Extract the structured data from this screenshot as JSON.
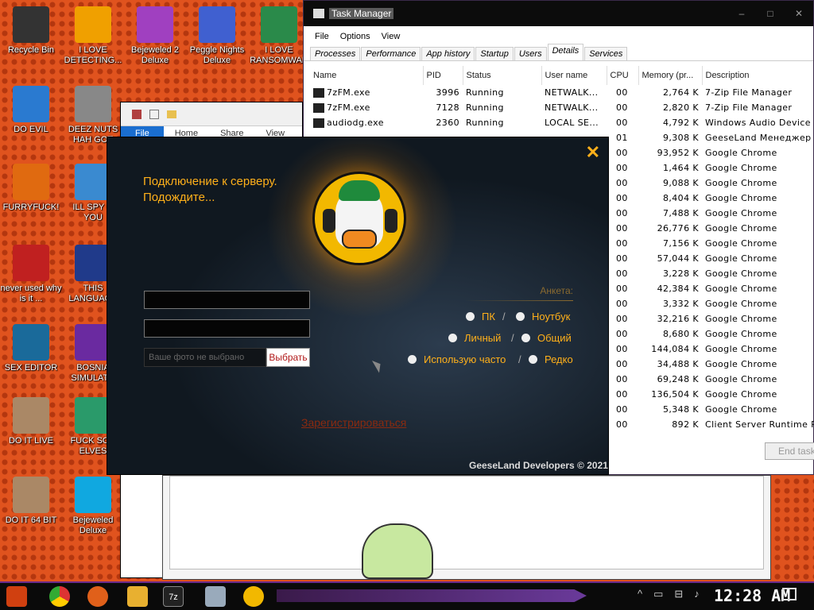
{
  "desktop": {
    "icons": [
      {
        "label": "Recycle Bin",
        "color": "#333"
      },
      {
        "label": "I LOVE DETECTING...",
        "color": "#f0a000"
      },
      {
        "label": "Bejeweled 2 Deluxe",
        "color": "#a040c0"
      },
      {
        "label": "Peggle Nights Deluxe",
        "color": "#4060d0"
      },
      {
        "label": "I LOVE RANSOMWAR",
        "color": "#2a8a4a"
      },
      {
        "label": "DO EVIL",
        "color": "#2a7ad0"
      },
      {
        "label": "DEEZ NUTS HAH GOT",
        "color": "#888"
      },
      {
        "label": "FURRYFUCK!",
        "color": "#e06a10"
      },
      {
        "label": "ILL SPY O YOU",
        "color": "#3a8ad0"
      },
      {
        "label": "never used why is it ...",
        "color": "#c02020"
      },
      {
        "label": "THIS LANGUAGE",
        "color": "#203a8a"
      },
      {
        "label": "SEX EDITOR",
        "color": "#1a6a9a"
      },
      {
        "label": "BOSNIA SIMULATO",
        "color": "#6a2aa0"
      },
      {
        "label": "DO IT LIVE",
        "color": "#aa8866"
      },
      {
        "label": "FUCK SON ELVES",
        "color": "#2a9a6a"
      },
      {
        "label": "DO IT 64 BIT",
        "color": "#aa8866"
      },
      {
        "label": "Bejeweled Deluxe",
        "color": "#10a8e0"
      }
    ]
  },
  "explorer": {
    "tabs": [
      "File",
      "Home",
      "Share",
      "View"
    ]
  },
  "task_manager": {
    "title": "Task Manager",
    "menu": [
      "File",
      "Options",
      "View"
    ],
    "tabs": [
      "Processes",
      "Performance",
      "App history",
      "Startup",
      "Users",
      "Details",
      "Services"
    ],
    "selected_tab": "Details",
    "columns": [
      "Name",
      "PID",
      "Status",
      "User name",
      "CPU",
      "Memory (pr...",
      "Description"
    ],
    "rows": [
      [
        "7zFM.exe",
        "3996",
        "Running",
        "NETWALK...",
        "00",
        "2,764 K",
        "7-Zip File Manager"
      ],
      [
        "7zFM.exe",
        "7128",
        "Running",
        "NETWALK...",
        "00",
        "2,820 K",
        "7-Zip File Manager"
      ],
      [
        "audiodg.exe",
        "2360",
        "Running",
        "LOCAL SE...",
        "00",
        "4,792 K",
        "Windows Audio Device ..."
      ],
      [
        "",
        "",
        "",
        "",
        "01",
        "9,308 K",
        "GeeseLand Менеджер"
      ],
      [
        "",
        "",
        "",
        "",
        "00",
        "93,952 K",
        "Google Chrome"
      ],
      [
        "",
        "",
        "",
        "",
        "00",
        "1,464 K",
        "Google Chrome"
      ],
      [
        "",
        "",
        "",
        "",
        "00",
        "9,088 K",
        "Google Chrome"
      ],
      [
        "",
        "",
        "",
        "",
        "00",
        "8,404 K",
        "Google Chrome"
      ],
      [
        "",
        "",
        "",
        "",
        "00",
        "7,488 K",
        "Google Chrome"
      ],
      [
        "",
        "",
        "",
        "",
        "00",
        "26,776 K",
        "Google Chrome"
      ],
      [
        "",
        "",
        "",
        "",
        "00",
        "7,156 K",
        "Google Chrome"
      ],
      [
        "",
        "",
        "",
        "",
        "00",
        "57,044 K",
        "Google Chrome"
      ],
      [
        "",
        "",
        "",
        "",
        "00",
        "3,228 K",
        "Google Chrome"
      ],
      [
        "",
        "",
        "",
        "",
        "00",
        "42,384 K",
        "Google Chrome"
      ],
      [
        "",
        "",
        "",
        "",
        "00",
        "3,332 K",
        "Google Chrome"
      ],
      [
        "",
        "",
        "",
        "",
        "00",
        "32,216 K",
        "Google Chrome"
      ],
      [
        "",
        "",
        "",
        "",
        "00",
        "8,680 K",
        "Google Chrome"
      ],
      [
        "",
        "",
        "",
        "",
        "00",
        "144,084 K",
        "Google Chrome"
      ],
      [
        "",
        "",
        "",
        "",
        "00",
        "34,488 K",
        "Google Chrome"
      ],
      [
        "",
        "",
        "",
        "",
        "00",
        "69,248 K",
        "Google Chrome"
      ],
      [
        "",
        "",
        "",
        "",
        "00",
        "136,504 K",
        "Google Chrome"
      ],
      [
        "",
        "",
        "",
        "",
        "00",
        "5,348 K",
        "Google Chrome"
      ],
      [
        "",
        "",
        "",
        "",
        "00",
        "892 K",
        "Client Server Runtime Pr..."
      ]
    ],
    "end_task_label": "End task"
  },
  "dialog": {
    "status_line1": "Подключение к серверу.",
    "status_line2": "Подождите...",
    "photo_placeholder": "Ваше фото не выбрано",
    "choose_button": "Выбрать",
    "profile_label": "Анкета:",
    "options": [
      {
        "a": "ПК",
        "b": "Ноутбук"
      },
      {
        "a": "Личный",
        "b": "Общий"
      },
      {
        "a": "Использую часто",
        "b": "Редко"
      }
    ],
    "separator": "/",
    "register_link": "Зарегистрироваться",
    "footer": "GeeseLand Developers © 2021",
    "close_glyph": "✕"
  },
  "taskbar": {
    "clock": "12:28 AM"
  }
}
